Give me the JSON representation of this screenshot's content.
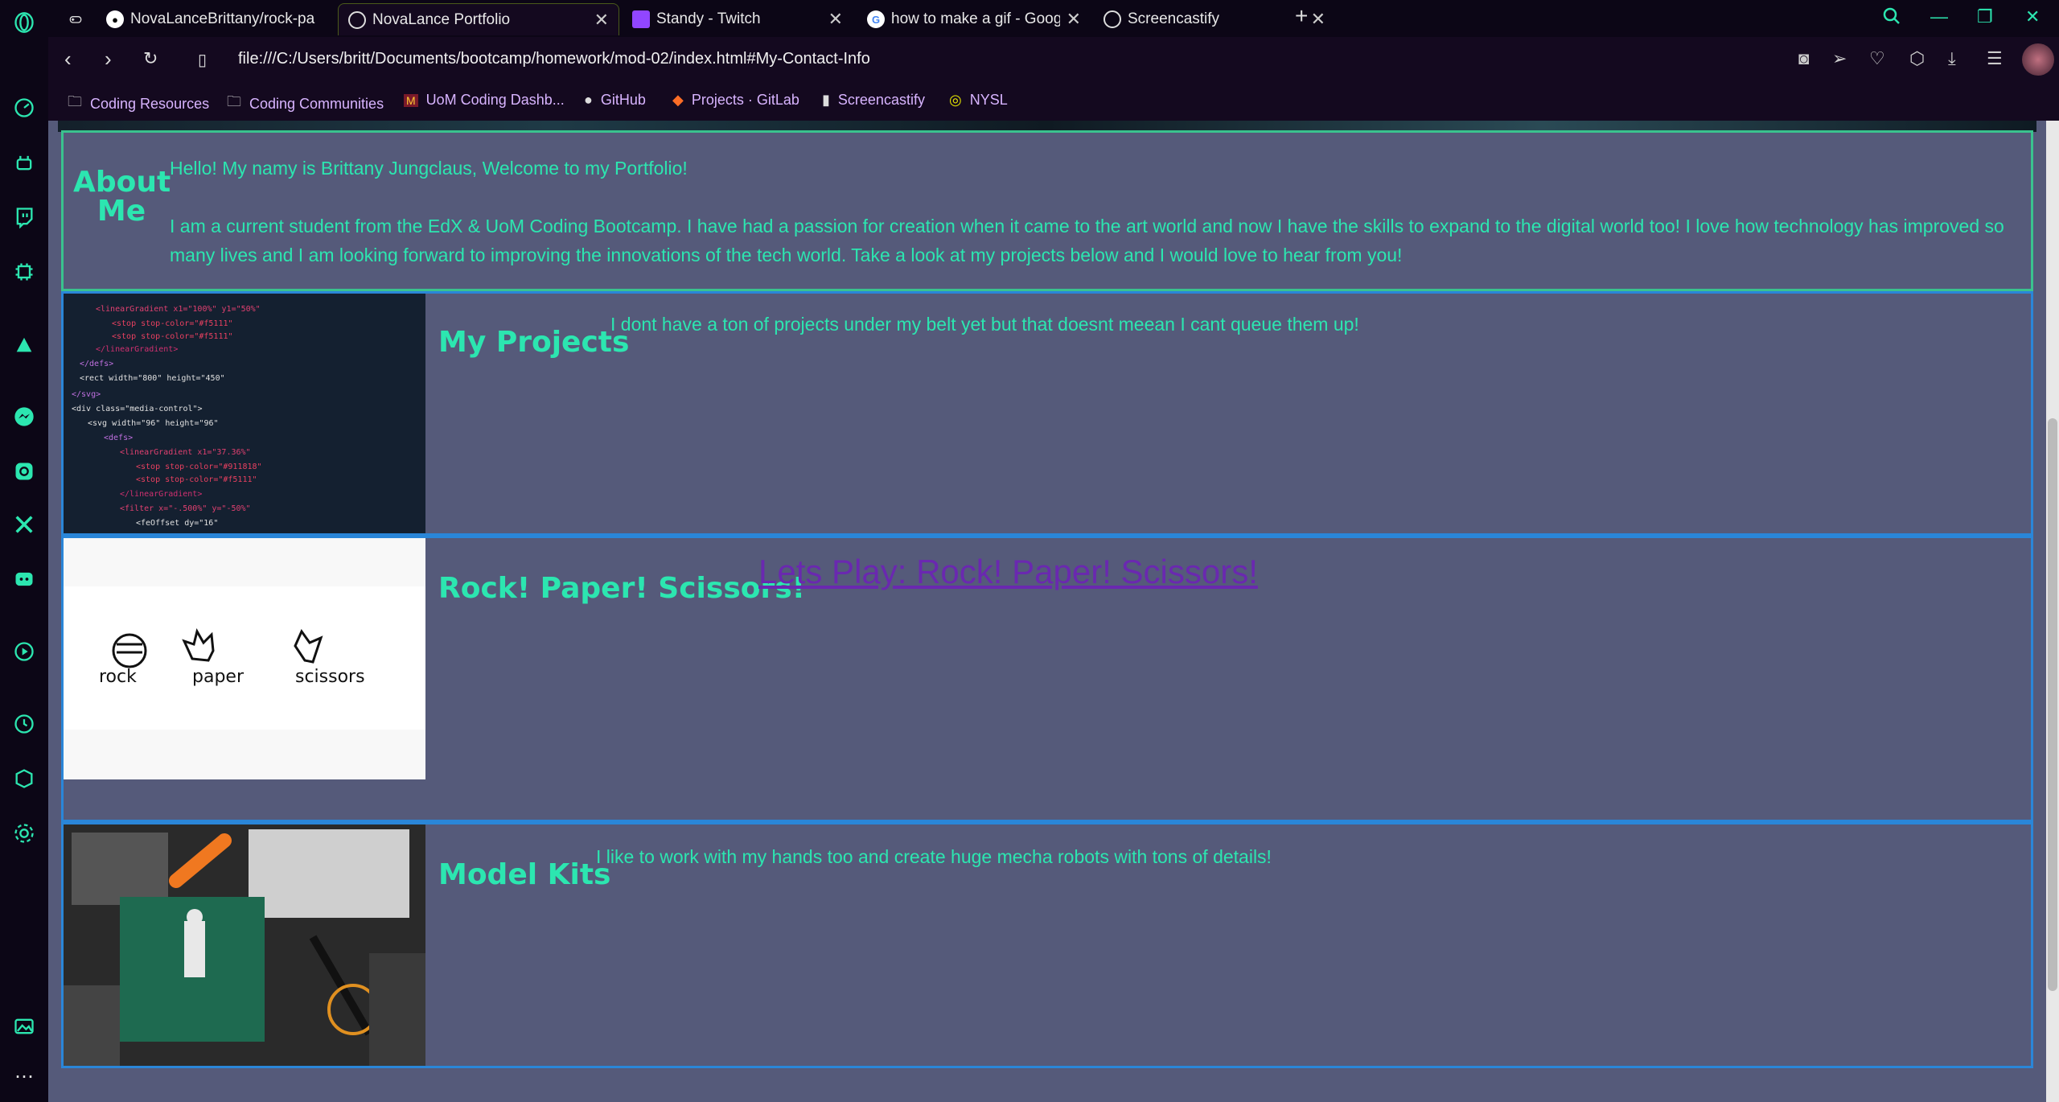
{
  "browser": {
    "tabs": [
      {
        "title": "NovaLanceBrittany/rock-pa",
        "icon": "github-icon"
      },
      {
        "title": "NovaLance Portfolio",
        "icon": "globe-icon",
        "active": true
      },
      {
        "title": "Standy - Twitch",
        "icon": "twitch-icon"
      },
      {
        "title": "how to make a gif - Google",
        "icon": "google-icon"
      },
      {
        "title": "Screencastify",
        "icon": "globe-icon"
      }
    ],
    "url": "file:///C:/Users/britt/Documents/bootcamp/homework/mod-02/index.html#My-Contact-Info",
    "bookmarks": [
      {
        "label": "Coding Resources",
        "icon": "folder-icon"
      },
      {
        "label": "Coding Communities",
        "icon": "folder-icon"
      },
      {
        "label": "UoM Coding Dashb...",
        "icon": "uom-icon"
      },
      {
        "label": "GitHub",
        "icon": "github-icon"
      },
      {
        "label": "Projects · GitLab",
        "icon": "gitlab-icon"
      },
      {
        "label": "Screencastify",
        "icon": "document-icon"
      },
      {
        "label": "NYSL",
        "icon": "nysl-icon"
      }
    ]
  },
  "page": {
    "about": {
      "title": "About Me",
      "greeting": "Hello! My namy is Brittany Jungclaus, Welcome to my Portfolio!",
      "body": "I am a current student from the EdX & UoM Coding Bootcamp. I have had a passion for creation when it came to the art world and now I have the skills to expand to the digital world too! I love how technology has improved so many lives and I am looking forward to improving the innovations of the tech world. Take a look at my projects below and I would love to hear from you!"
    },
    "projects": {
      "title": "My Projects",
      "text": "I dont have a ton of projects under my belt yet but that doesnt meean I cant queue them up!"
    },
    "rps": {
      "title": "Rock! Paper! Scissors!",
      "link": "Lets Play: Rock! Paper! Scissors!",
      "image_labels": [
        "rock",
        "paper",
        "scissors"
      ]
    },
    "models": {
      "title": "Model Kits",
      "text": "I like to work with my hands too and create huge mecha robots with tons of details!"
    }
  },
  "colors": {
    "accent": "#2ce6b0",
    "page_bg": "#555a7a",
    "section_border": "#2a86d8",
    "link": "#6a28b0"
  }
}
